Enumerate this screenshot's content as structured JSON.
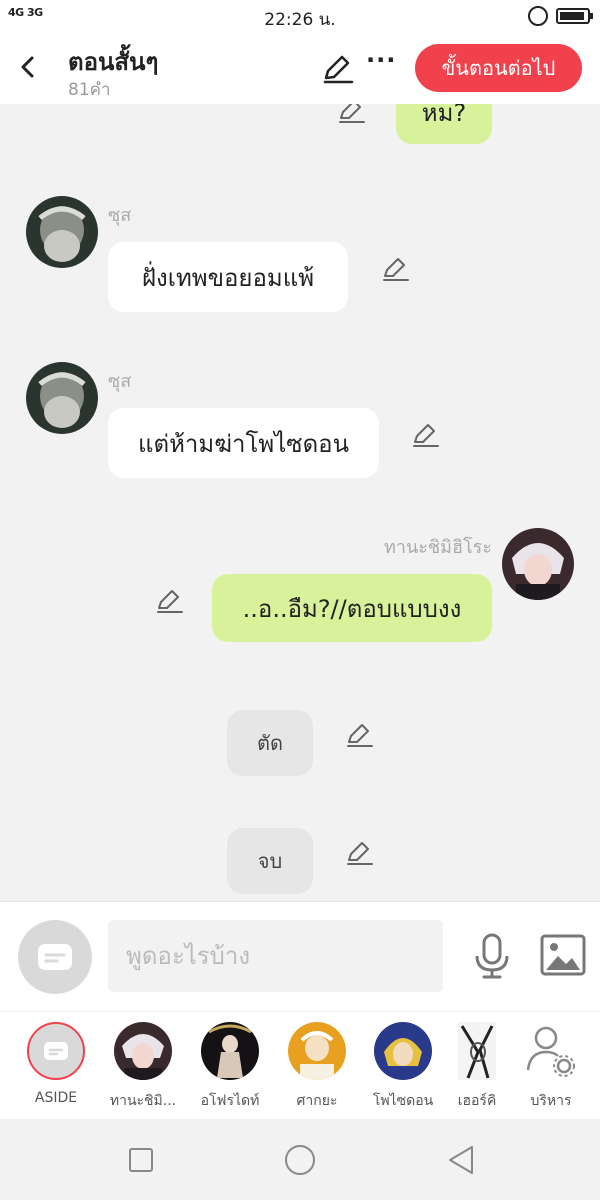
{
  "status_bar": {
    "signal_text": "4G 3G",
    "time": "22:26 น."
  },
  "header": {
    "title": "ตอนสั้นๆ",
    "word_count": "81คำ",
    "next_step_label": "ขั้นตอนต่อไป",
    "icons": [
      "back-arrow-icon",
      "pencil-icon",
      "more-icon"
    ]
  },
  "chat": {
    "partial_message": "หม?",
    "messages": [
      {
        "speaker": "ซุส",
        "text": "ฝั่งเทพขอยอมแพ้",
        "side": "left"
      },
      {
        "speaker": "ซุส",
        "text": "แต่ห้ามฆ่าโพไซดอน",
        "side": "left"
      },
      {
        "speaker": "ทานะชิมิฮิโระ",
        "text": "..อ..อืม?//ตอบแบบงง",
        "side": "right"
      }
    ],
    "narration": [
      {
        "text": "ตัด"
      },
      {
        "text": "จบ"
      }
    ]
  },
  "input": {
    "placeholder": "พูดอะไรบ้าง"
  },
  "characters": [
    {
      "label": "ASIDE",
      "selected": true
    },
    {
      "label": "ทานะชิมิ..."
    },
    {
      "label": "อโฟรไดท์"
    },
    {
      "label": "ศากยะ"
    },
    {
      "label": "โพไซดอน"
    },
    {
      "label": "เฮอร์คิ"
    },
    {
      "label": "บริหาร"
    }
  ],
  "colors": {
    "accent": "#f0414c",
    "green_bubble": "#d7f29a",
    "white_bubble": "#ffffff",
    "background": "#f2f2f2"
  }
}
